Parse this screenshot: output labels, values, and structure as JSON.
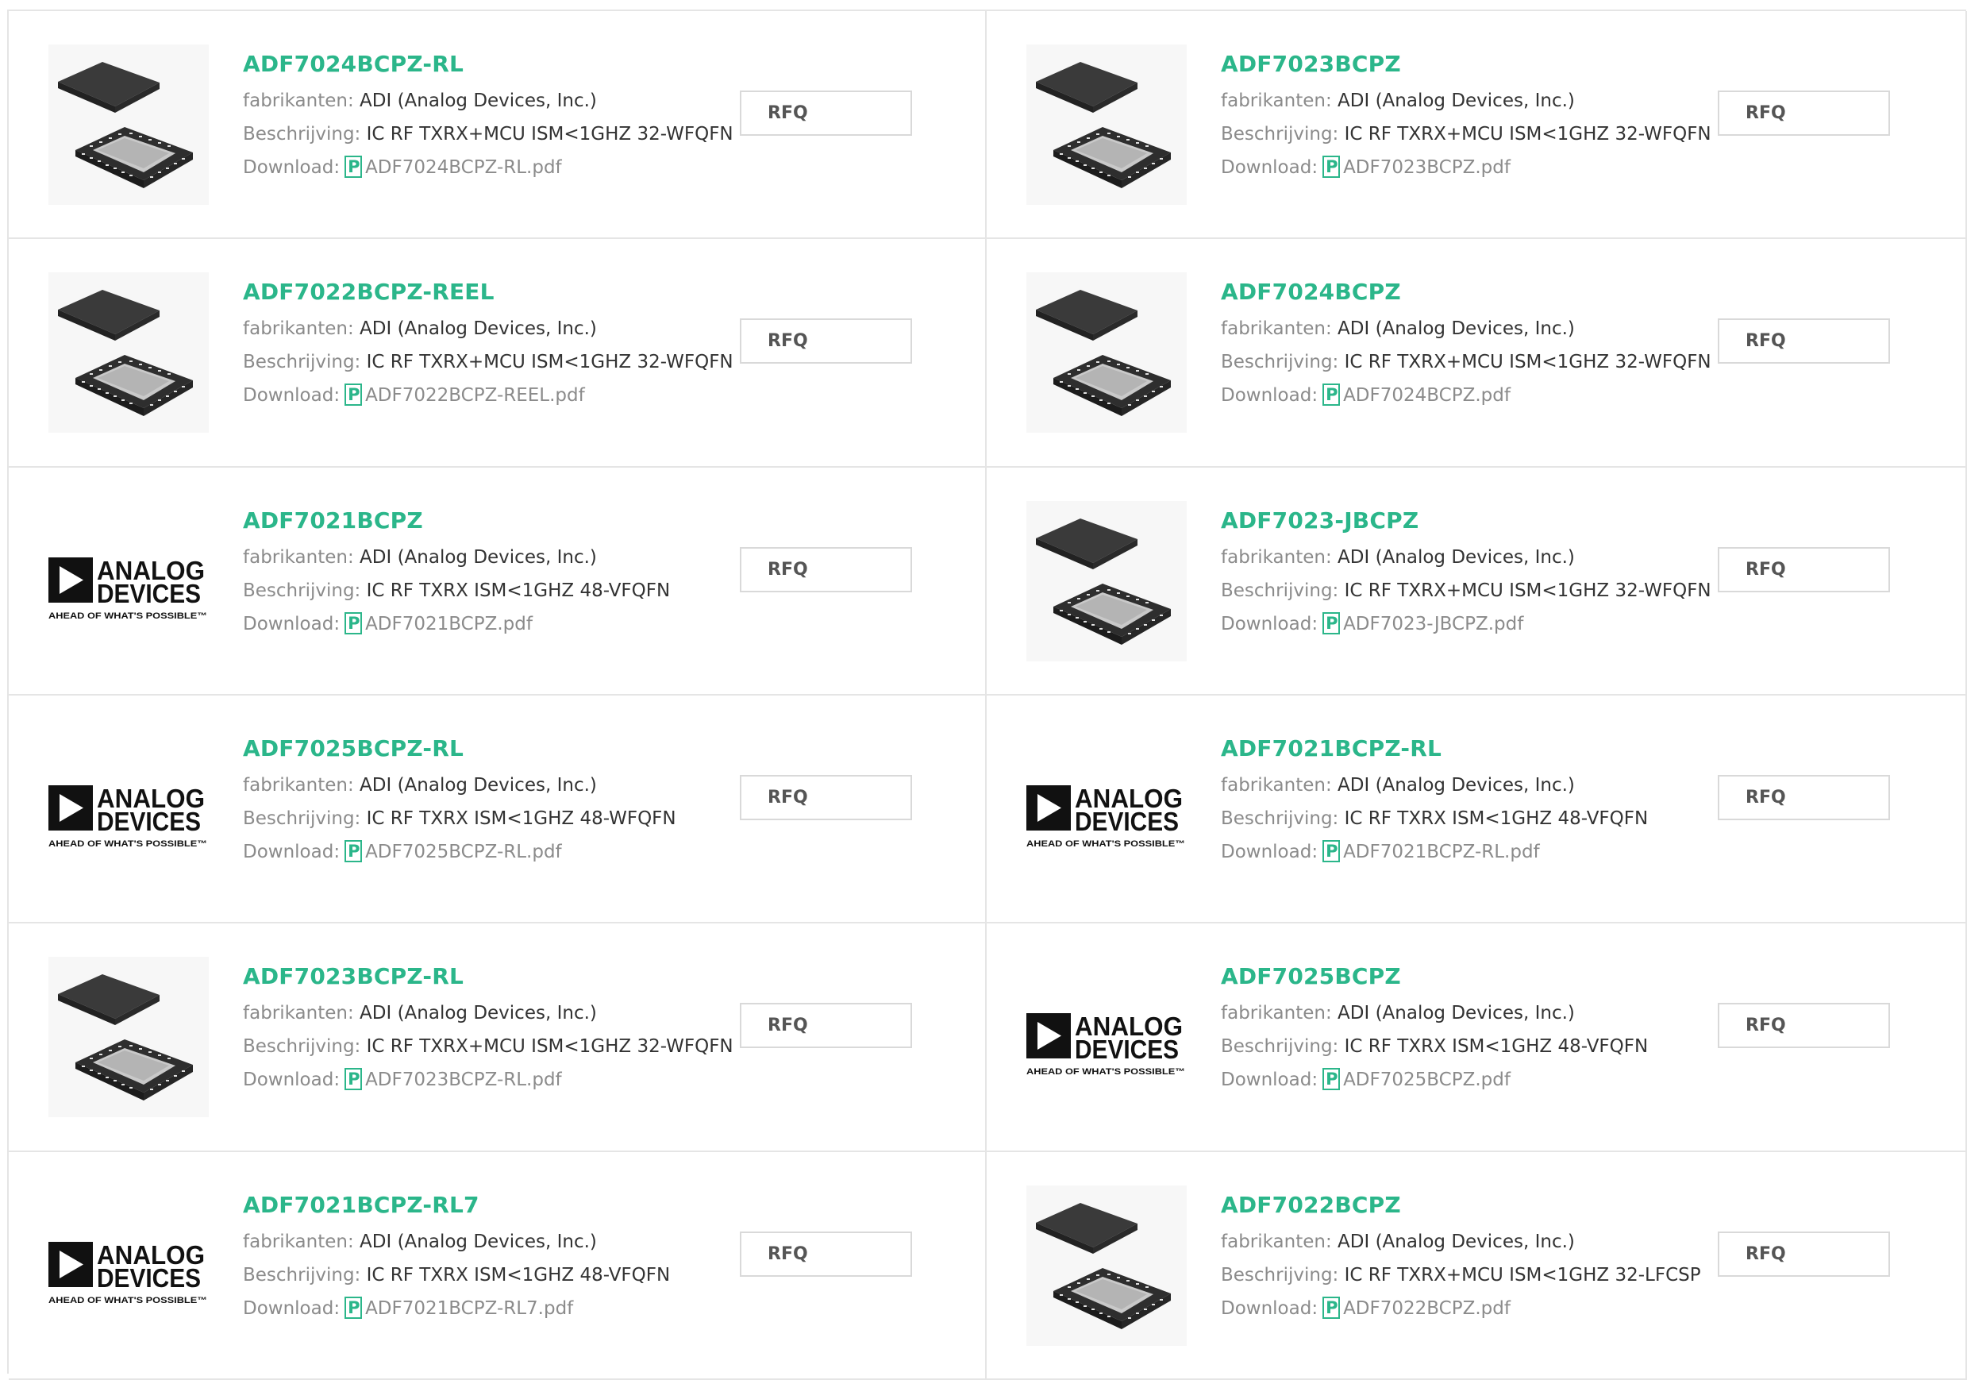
{
  "labels": {
    "manufacturer": "fabrikanten:",
    "description": "Beschrijving:",
    "download": "Download:",
    "rfq": "RFQ",
    "pdf_glyph": "P"
  },
  "logo": {
    "line1": "ANALOG",
    "line2": "DEVICES",
    "tagline": "AHEAD OF WHAT'S POSSIBLE™"
  },
  "products": [
    {
      "part": "ADF7024BCPZ-RL",
      "image": "chip",
      "manufacturer": "ADI (Analog Devices, Inc.)",
      "description": "IC RF TXRX+MCU ISM<1GHZ 32-WFQFN",
      "pdf": "ADF7024BCPZ-RL.pdf"
    },
    {
      "part": "ADF7023BCPZ",
      "image": "chip",
      "manufacturer": "ADI (Analog Devices, Inc.)",
      "description": "IC RF TXRX+MCU ISM<1GHZ 32-WFQFN",
      "pdf": "ADF7023BCPZ.pdf"
    },
    {
      "part": "ADF7022BCPZ-REEL",
      "image": "chip",
      "manufacturer": "ADI (Analog Devices, Inc.)",
      "description": "IC RF TXRX+MCU ISM<1GHZ 32-WFQFN",
      "pdf": "ADF7022BCPZ-REEL.pdf"
    },
    {
      "part": "ADF7024BCPZ",
      "image": "chip",
      "manufacturer": "ADI (Analog Devices, Inc.)",
      "description": "IC RF TXRX+MCU ISM<1GHZ 32-WFQFN",
      "pdf": "ADF7024BCPZ.pdf"
    },
    {
      "part": "ADF7021BCPZ",
      "image": "logo",
      "manufacturer": "ADI (Analog Devices, Inc.)",
      "description": "IC RF TXRX ISM<1GHZ 48-VFQFN",
      "pdf": "ADF7021BCPZ.pdf"
    },
    {
      "part": "ADF7023-JBCPZ",
      "image": "chip",
      "manufacturer": "ADI (Analog Devices, Inc.)",
      "description": "IC RF TXRX+MCU ISM<1GHZ 32-WFQFN",
      "pdf": "ADF7023-JBCPZ.pdf"
    },
    {
      "part": "ADF7025BCPZ-RL",
      "image": "logo",
      "manufacturer": "ADI (Analog Devices, Inc.)",
      "description": "IC RF TXRX ISM<1GHZ 48-WFQFN",
      "pdf": "ADF7025BCPZ-RL.pdf"
    },
    {
      "part": "ADF7021BCPZ-RL",
      "image": "logo",
      "manufacturer": "ADI (Analog Devices, Inc.)",
      "description": "IC RF TXRX ISM<1GHZ 48-VFQFN",
      "pdf": "ADF7021BCPZ-RL.pdf"
    },
    {
      "part": "ADF7023BCPZ-RL",
      "image": "chip",
      "manufacturer": "ADI (Analog Devices, Inc.)",
      "description": "IC RF TXRX+MCU ISM<1GHZ 32-WFQFN",
      "pdf": "ADF7023BCPZ-RL.pdf"
    },
    {
      "part": "ADF7025BCPZ",
      "image": "logo",
      "manufacturer": "ADI (Analog Devices, Inc.)",
      "description": "IC RF TXRX ISM<1GHZ 48-VFQFN",
      "pdf": "ADF7025BCPZ.pdf"
    },
    {
      "part": "ADF7021BCPZ-RL7",
      "image": "logo",
      "manufacturer": "ADI (Analog Devices, Inc.)",
      "description": "IC RF TXRX ISM<1GHZ 48-VFQFN",
      "pdf": "ADF7021BCPZ-RL7.pdf"
    },
    {
      "part": "ADF7022BCPZ",
      "image": "chip",
      "manufacturer": "ADI (Analog Devices, Inc.)",
      "description": "IC RF TXRX+MCU ISM<1GHZ 32-LFCSP",
      "pdf": "ADF7022BCPZ.pdf"
    }
  ]
}
